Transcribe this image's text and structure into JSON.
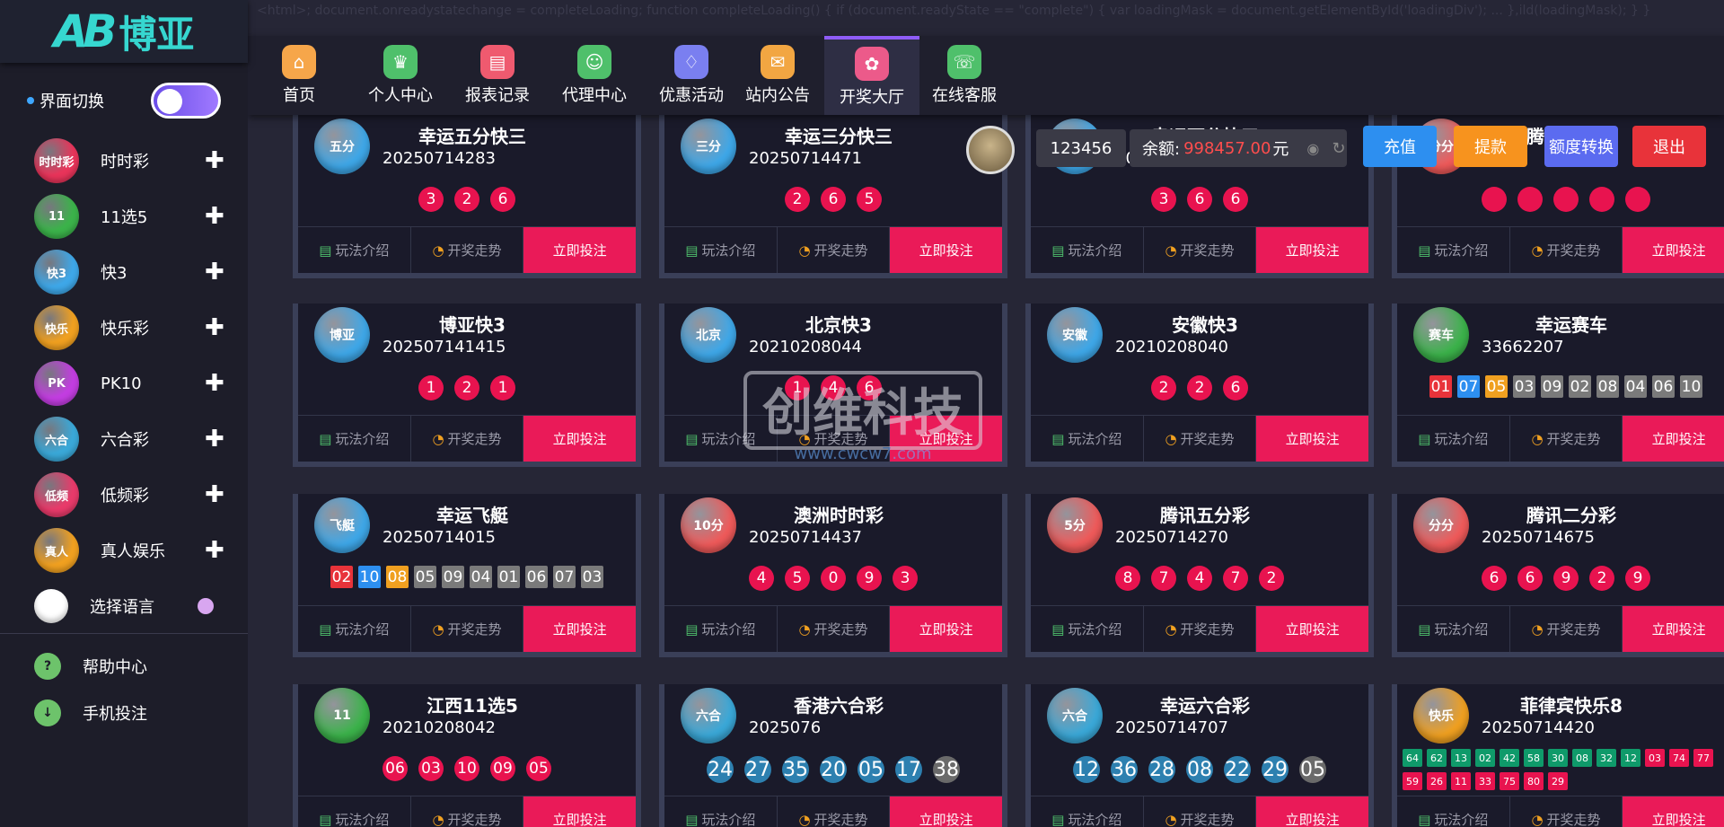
{
  "brand": {
    "logo_mark": "AB",
    "logo_text": "博亚"
  },
  "code_line": "<html>; document.onreadystatechange = completeLoading; function completeLoading() { if (document.readyState == \"complete\") { var loadingMask = document.getElementById('loadingDiv'); ... },ild(loadingMask); } }",
  "sidebar": {
    "theme_label": "界面切换",
    "items": [
      {
        "label": "时时彩",
        "icon": "时时彩",
        "color": "#e8345a"
      },
      {
        "label": "11选5",
        "icon": "11",
        "color": "#3bb24a"
      },
      {
        "label": "快3",
        "icon": "快3",
        "color": "#3ea7e8"
      },
      {
        "label": "快乐彩",
        "icon": "快乐",
        "color": "#f0a020"
      },
      {
        "label": "PK10",
        "icon": "PK",
        "color": "#c23de0"
      },
      {
        "label": "六合彩",
        "icon": "六合",
        "color": "#3aa8d8"
      },
      {
        "label": "低频彩",
        "icon": "低频",
        "color": "#e83a6a"
      },
      {
        "label": "真人娱乐",
        "icon": "真人",
        "color": "#f0a020"
      },
      {
        "label": "选择语言",
        "icon": "",
        "color": "#ffffff"
      }
    ],
    "help": [
      {
        "label": "帮助中心",
        "icon": "?"
      },
      {
        "label": "手机投注",
        "icon": "↓"
      }
    ]
  },
  "nav": {
    "tabs": [
      {
        "label": "首页",
        "color": "#f6a64a",
        "icon": "⌂"
      },
      {
        "label": "个人中心",
        "color": "#4fc06b",
        "icon": "♛"
      },
      {
        "label": "报表记录",
        "color": "#ef5a6f",
        "icon": "▤"
      },
      {
        "label": "代理中心",
        "color": "#4fc06b",
        "icon": "☺"
      },
      {
        "label": "优惠活动",
        "color": "#7a7ff0",
        "icon": "♢"
      },
      {
        "label": "站内公告",
        "color": "#f2a642",
        "icon": "✉"
      },
      {
        "label": "开奖大厅",
        "color": "#ec5a8a",
        "icon": "✿"
      },
      {
        "label": "在线客服",
        "color": "#4fc06b",
        "icon": "☏"
      }
    ],
    "active": "开奖大厅"
  },
  "user": {
    "username": "123456",
    "balance_label": "余额:",
    "balance_value": "998457.00",
    "balance_unit": "元",
    "buttons": [
      {
        "label": "充值",
        "color": "#2d8ff0"
      },
      {
        "label": "提款",
        "color": "#f7931e"
      },
      {
        "label": "额度转换",
        "color": "#5b6bf0"
      },
      {
        "label": "退出",
        "color": "#e8333a"
      }
    ]
  },
  "actions": {
    "rules": "玩法介绍",
    "trend": "开奖走势",
    "bet": "立即投注"
  },
  "watermark": {
    "cn": "创维科技",
    "url": "www.cwcw7.com"
  },
  "lotteries": [
    {
      "name": "幸运五分快三",
      "issue": "20250714283",
      "type": "round",
      "balls": [
        "3",
        "2",
        "6"
      ],
      "icon": "五分",
      "color": "#3ea7e8"
    },
    {
      "name": "幸运三分快三",
      "issue": "20250714471",
      "type": "round",
      "balls": [
        "2",
        "6",
        "5"
      ],
      "icon": "三分",
      "color": "#3ea7e8"
    },
    {
      "name": "幸运两分快三",
      "issue": "20250714659",
      "type": "round",
      "balls": [
        "3",
        "6",
        "6"
      ],
      "icon": "两分",
      "color": "#3ea7e8"
    },
    {
      "name": "腾讯分分彩",
      "issue": "",
      "type": "round",
      "balls": [
        "",
        "",
        "",
        "",
        ""
      ],
      "icon": "分分",
      "color": "#ef5a5a"
    },
    {
      "name": "博亚快3",
      "issue": "202507141415",
      "type": "round",
      "balls": [
        "1",
        "2",
        "1"
      ],
      "icon": "博亚",
      "color": "#3ea7e8"
    },
    {
      "name": "北京快3",
      "issue": "20210208044",
      "type": "round",
      "balls": [
        "1",
        "4",
        "6"
      ],
      "icon": "北京",
      "color": "#3ea7e8"
    },
    {
      "name": "安徽快3",
      "issue": "20210208040",
      "type": "round",
      "balls": [
        "2",
        "2",
        "6"
      ],
      "icon": "安徽",
      "color": "#3ea7e8"
    },
    {
      "name": "幸运赛车",
      "issue": "33662207",
      "type": "square",
      "balls": [
        "01",
        "07",
        "05",
        "03",
        "09",
        "02",
        "08",
        "04",
        "06",
        "10"
      ],
      "ballColors": [
        "#e8333a",
        "#2d8ff0",
        "#f0a020",
        "#7a7a7a",
        "#7a7a7a",
        "#7a7a7a",
        "#7a7a7a",
        "#7a7a7a",
        "#7a7a7a",
        "#7a7a7a"
      ],
      "icon": "赛车",
      "color": "#3bb24a"
    },
    {
      "name": "幸运飞艇",
      "issue": "20250714015",
      "type": "square",
      "balls": [
        "02",
        "10",
        "08",
        "05",
        "09",
        "04",
        "01",
        "06",
        "07",
        "03"
      ],
      "ballColors": [
        "#e8333a",
        "#2d8ff0",
        "#f0a020",
        "#7a7a7a",
        "#7a7a7a",
        "#7a7a7a",
        "#7a7a7a",
        "#7a7a7a",
        "#7a7a7a",
        "#7a7a7a"
      ],
      "icon": "飞艇",
      "color": "#3ea7e8"
    },
    {
      "name": "澳洲时时彩",
      "issue": "20250714437",
      "type": "round",
      "balls": [
        "4",
        "5",
        "0",
        "9",
        "3"
      ],
      "icon": "10分",
      "color": "#ef5a5a"
    },
    {
      "name": "腾讯五分彩",
      "issue": "20250714270",
      "type": "round",
      "balls": [
        "8",
        "7",
        "4",
        "7",
        "2"
      ],
      "icon": "5分",
      "color": "#ef5a5a"
    },
    {
      "name": "腾讯二分彩",
      "issue": "20250714675",
      "type": "round",
      "balls": [
        "6",
        "6",
        "9",
        "2",
        "9"
      ],
      "icon": "分分",
      "color": "#ef5a5a"
    },
    {
      "name": "江西11选5",
      "issue": "20210208042",
      "type": "round",
      "balls": [
        "06",
        "03",
        "10",
        "09",
        "05"
      ],
      "icon": "11",
      "color": "#3bb24a"
    },
    {
      "name": "香港六合彩",
      "issue": "2025076",
      "type": "lh",
      "balls": [
        "24",
        "27",
        "35",
        "20",
        "05",
        "17",
        "38"
      ],
      "icon": "六合",
      "color": "#3aa8d8"
    },
    {
      "name": "幸运六合彩",
      "issue": "20250714707",
      "type": "lh",
      "balls": [
        "12",
        "36",
        "28",
        "08",
        "22",
        "29",
        "05"
      ],
      "icon": "六合",
      "color": "#3aa8d8"
    },
    {
      "name": "菲律宾快乐8",
      "issue": "20250714420",
      "type": "mini",
      "balls": [
        "64",
        "62",
        "13",
        "02",
        "42",
        "58",
        "30",
        "08",
        "32",
        "12",
        "03",
        "74",
        "77",
        "59",
        "26",
        "11",
        "33",
        "75",
        "80",
        "29"
      ],
      "icon": "快乐",
      "color": "#f0a020"
    }
  ]
}
